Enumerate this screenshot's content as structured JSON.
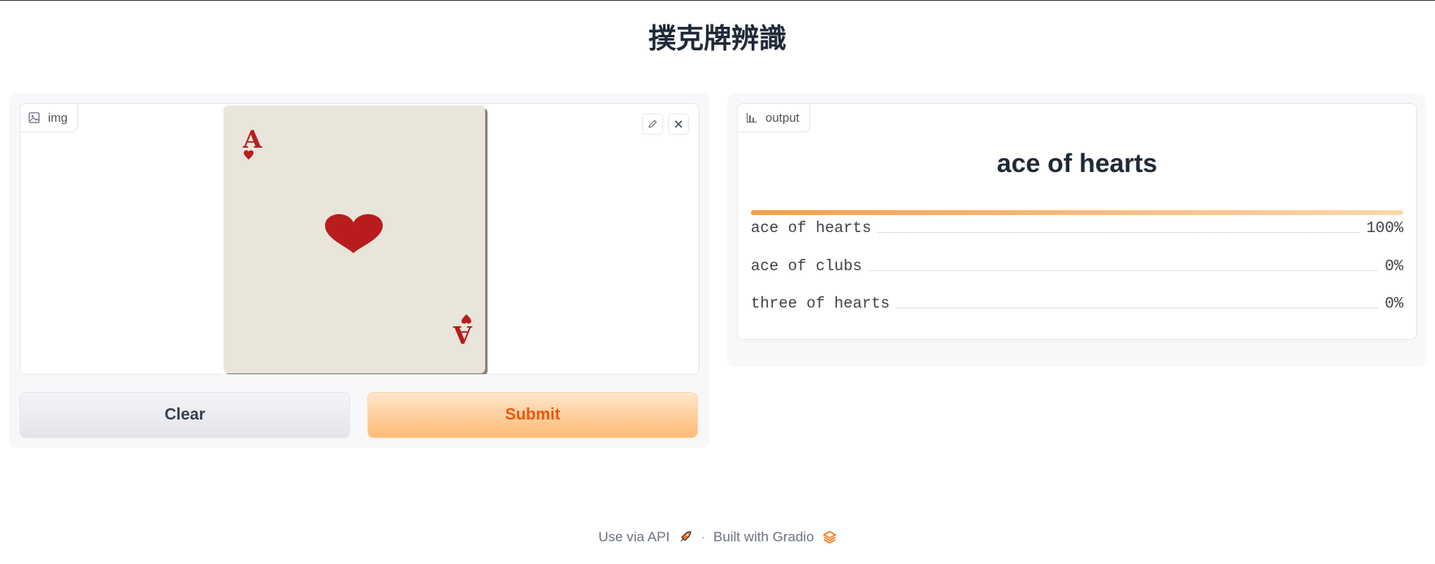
{
  "header": {
    "title": "撲克牌辨識"
  },
  "input_panel": {
    "label": "img",
    "buttons": {
      "clear": "Clear",
      "submit": "Submit"
    }
  },
  "card_image": {
    "rank": "A",
    "suit_symbol": "♥",
    "colors": {
      "suit": "#b91c1c",
      "paper": "#e9e5db"
    }
  },
  "output_panel": {
    "label": "output",
    "top_label": "ace of hearts",
    "confidences": [
      {
        "label": "ace of hearts",
        "value": "100%"
      },
      {
        "label": "ace of clubs",
        "value": "0%"
      },
      {
        "label": "three of hearts",
        "value": "0%"
      }
    ],
    "top_confidence_fraction": 1.0
  },
  "footer": {
    "api_link": "Use via API",
    "separator": "·",
    "built_with": "Built with Gradio"
  },
  "colors": {
    "accent": "#f97316",
    "accent_light": "#fed7aa"
  }
}
